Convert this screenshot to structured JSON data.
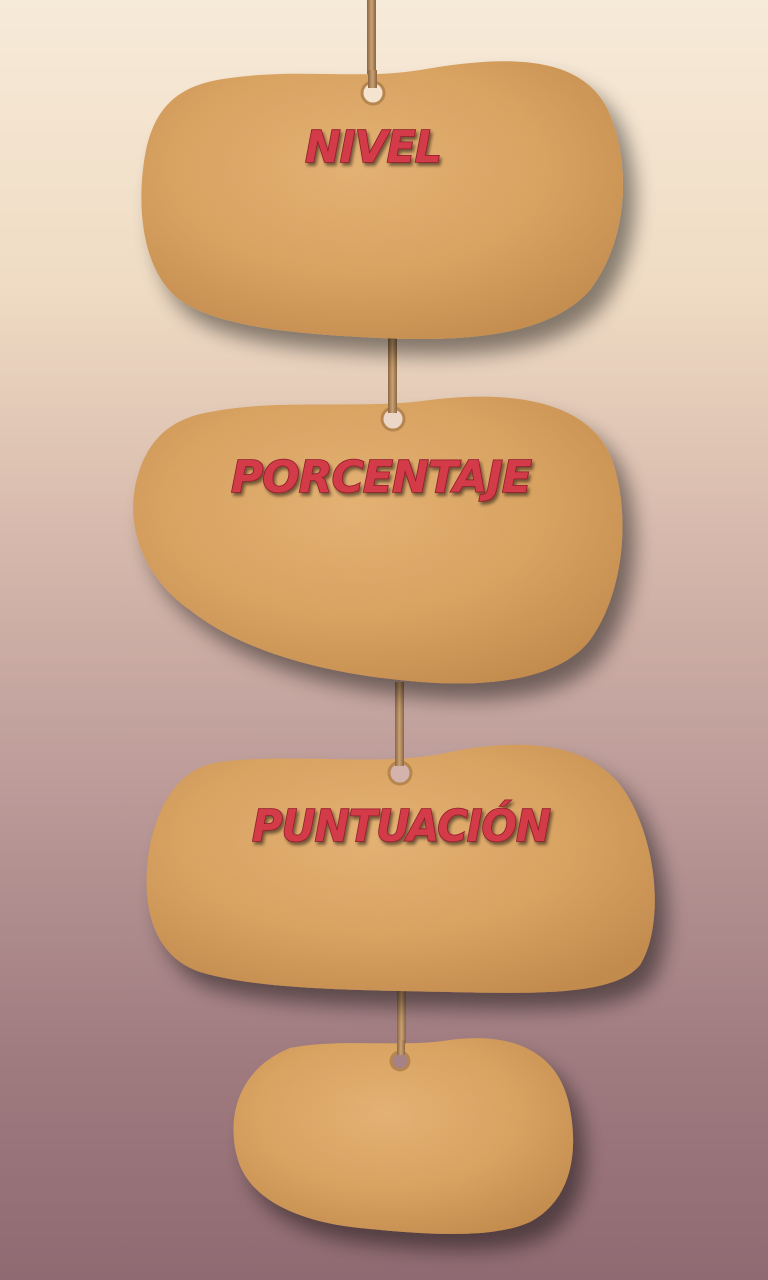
{
  "stones": [
    {
      "id": "nivel",
      "label": "NIVEL"
    },
    {
      "id": "porcentaje",
      "label": "PORCENTAJE"
    },
    {
      "id": "puntuacion",
      "label": "PUNTUACIÓN"
    },
    {
      "id": "extra",
      "label": ""
    }
  ],
  "colors": {
    "stone": "#dda460",
    "stone_dark": "#c4894a",
    "label_fill": "#d33a48",
    "label_outline": "#8e1c2a",
    "rope": "#b58a5c"
  }
}
